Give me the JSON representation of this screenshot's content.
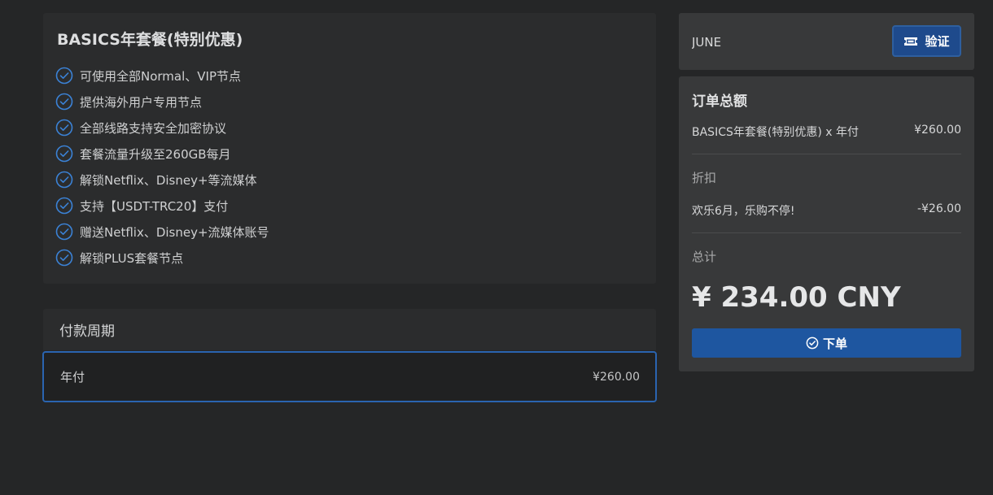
{
  "plan": {
    "title": "BASICS年套餐(特别优惠)",
    "features": [
      "可使用全部Normal、VIP节点",
      "提供海外用户专用节点",
      "全部线路支持安全加密协议",
      "套餐流量升级至260GB每月",
      "解锁Netflix、Disney+等流媒体",
      "支持【USDT-TRC20】支付",
      "赠送Netflix、Disney+流媒体账号",
      "解锁PLUS套餐节点"
    ],
    "check_icon": "check-circle-icon",
    "accent_color": "#3b82d6"
  },
  "period": {
    "header": "付款周期",
    "option_name": "年付",
    "option_price": "¥260.00",
    "selected_border_color": "#2a64b0"
  },
  "coupon": {
    "value": "JUNE",
    "verify_label": "验证",
    "verify_icon": "ticket-icon"
  },
  "summary": {
    "title": "订单总额",
    "item_label": "BASICS年套餐(特别优惠) x 年付",
    "item_price": "¥260.00",
    "discount_label": "折扣",
    "discount_name": "欢乐6月，乐购不停!",
    "discount_value": "-¥26.00",
    "total_label": "总计",
    "total_amount": "¥ 234.00 CNY",
    "order_label": "下单",
    "order_icon": "check-circle-icon",
    "button_color": "#1e56a0"
  }
}
